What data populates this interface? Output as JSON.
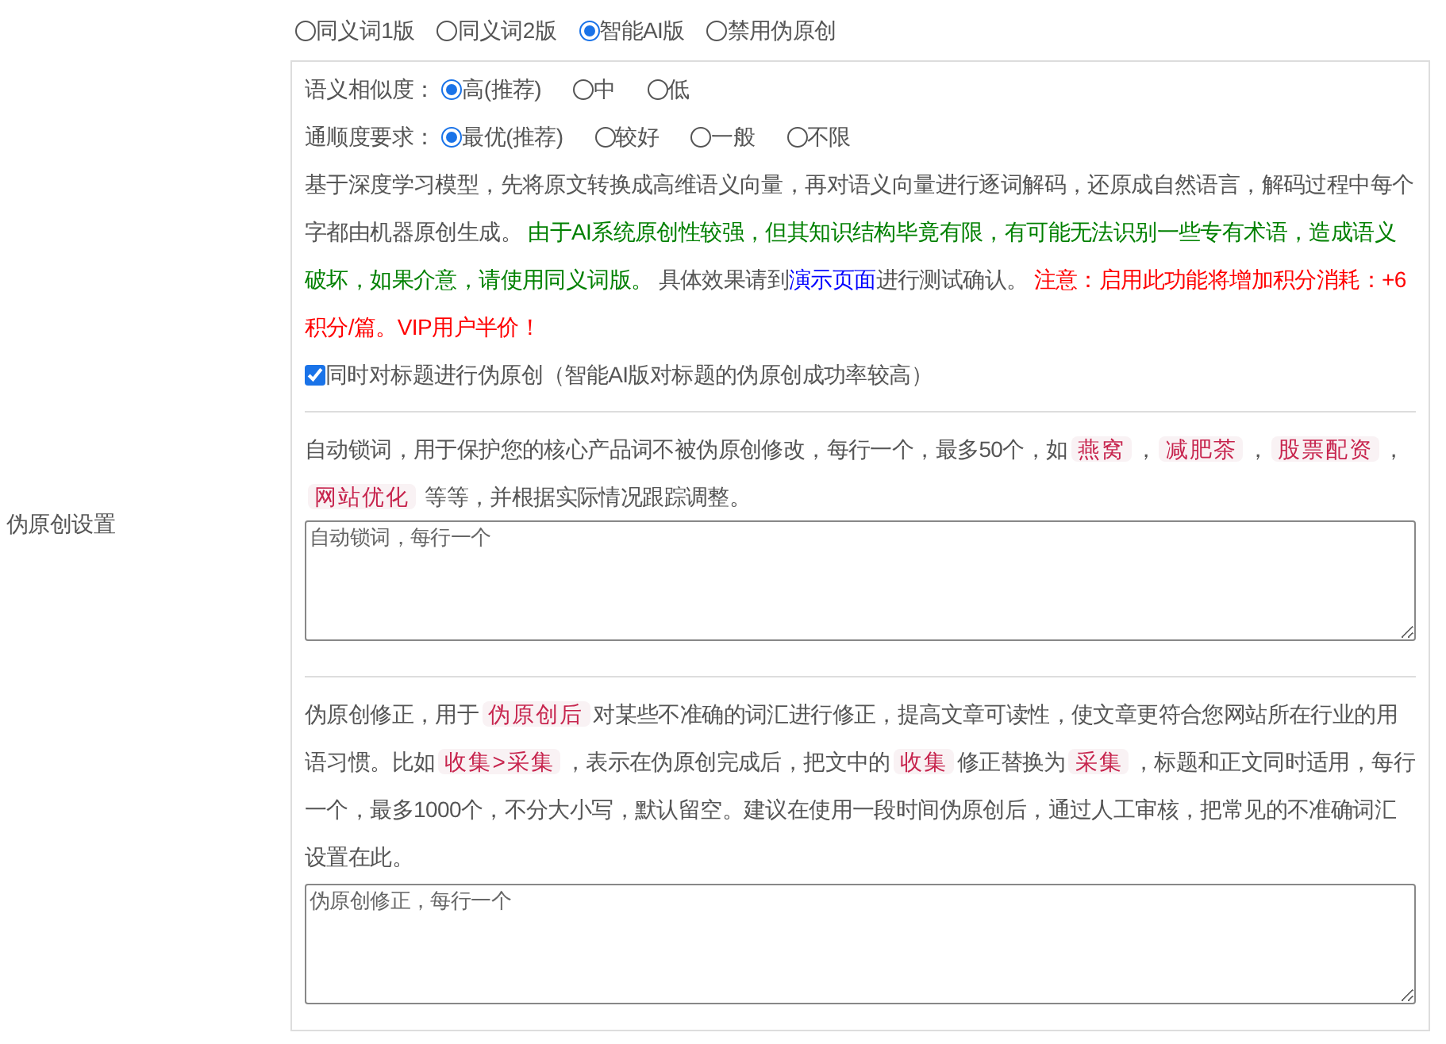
{
  "section_label": "伪原创设置",
  "modes": [
    {
      "label": "同义词1版",
      "selected": false
    },
    {
      "label": "同义词2版",
      "selected": false
    },
    {
      "label": "智能AI版",
      "selected": true
    },
    {
      "label": "禁用伪原创",
      "selected": false
    }
  ],
  "similarity": {
    "label": "语义相似度：",
    "options": [
      {
        "label": "高(推荐)",
        "selected": true
      },
      {
        "label": "中",
        "selected": false
      },
      {
        "label": "低",
        "selected": false
      }
    ]
  },
  "fluency": {
    "label": "通顺度要求：",
    "options": [
      {
        "label": "最优(推荐)",
        "selected": true
      },
      {
        "label": "较好",
        "selected": false
      },
      {
        "label": "一般",
        "selected": false
      },
      {
        "label": "不限",
        "selected": false
      }
    ]
  },
  "ai_description": [
    {
      "kind": "text",
      "text": "基于深度学习模型，先将原文转换成高维语义向量，再对语义向量进行逐词解码，还原成自然语言，解码过程中每个字都由机器原创生成。 "
    },
    {
      "kind": "notice",
      "text": "由于AI系统原创性较强，但其知识结构毕竟有限，有可能无法识别一些专有术语，造成语义破坏，如果介意，请使用同义词版。"
    },
    {
      "kind": "text",
      "text": " 具体效果请到"
    },
    {
      "kind": "link",
      "text": "演示页面"
    },
    {
      "kind": "text",
      "text": "进行测试确认。 "
    },
    {
      "kind": "warning",
      "text": "注意：启用此功能将增加积分消耗：+6积分/篇。VIP用户半价！"
    }
  ],
  "title_option": {
    "label": "同时对标题进行伪原创（智能AI版对标题的伪原创成功率较高）",
    "checked": true
  },
  "lock_words": {
    "description": [
      {
        "kind": "text",
        "text": "自动锁词，用于保护您的核心产品词不被伪原创修改，每行一个，最多50个，如"
      },
      {
        "kind": "code",
        "text": "燕窝"
      },
      {
        "kind": "text",
        "text": "，"
      },
      {
        "kind": "code",
        "text": "减肥茶"
      },
      {
        "kind": "text",
        "text": "，"
      },
      {
        "kind": "code",
        "text": "股票配资"
      },
      {
        "kind": "text",
        "text": "，"
      },
      {
        "kind": "code",
        "text": "网站优化"
      },
      {
        "kind": "text",
        "text": " 等等，并根据实际情况跟踪调整。"
      }
    ],
    "textarea": {
      "placeholder": "自动锁词，每行一个"
    }
  },
  "corrections": {
    "description": [
      {
        "kind": "text",
        "text": "伪原创修正，用于"
      },
      {
        "kind": "code",
        "text": "伪原创后"
      },
      {
        "kind": "text",
        "text": "对某些不准确的词汇进行修正，提高文章可读性，使文章更符合您网站所在行业的用语习惯。比如"
      },
      {
        "kind": "code",
        "text": "收集>采集"
      },
      {
        "kind": "text",
        "text": "，表示在伪原创完成后，把文中的"
      },
      {
        "kind": "code",
        "text": "收集"
      },
      {
        "kind": "text",
        "text": "修正替换为"
      },
      {
        "kind": "code",
        "text": "采集"
      },
      {
        "kind": "text",
        "text": "，标题和正文同时适用，每行一个，最多1000个，不分大小写，默认留空。建议在使用一段时间伪原创后，通过人工审核，把常见的不准确词汇设置在此。"
      }
    ],
    "textarea": {
      "placeholder": "伪原创修正，每行一个"
    }
  }
}
